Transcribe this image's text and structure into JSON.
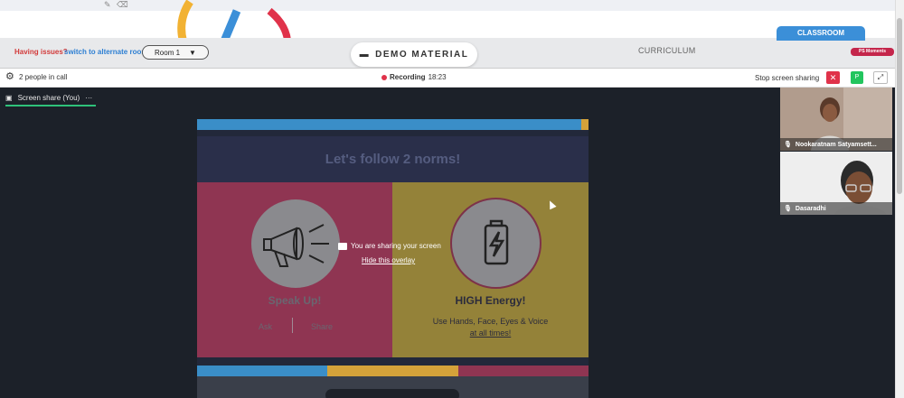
{
  "header": {
    "having_issues": "Having issues?",
    "switch_room": "switch to alternate room",
    "room": "Room 1",
    "demo_material": "DEMO MATERIAL",
    "curriculum": "CURRICULUM",
    "classroom": "CLASSROOM",
    "ps_moments": "PS Moments"
  },
  "callbar": {
    "people_in_call": "2 people in call",
    "recording_label": "Recording",
    "recording_time": "18:23",
    "stop_screen_sharing": "Stop screen sharing",
    "participant_initial": "P"
  },
  "screen_share_tab": {
    "label": "Screen share (You)",
    "menu": "···"
  },
  "slide": {
    "title": "Let's follow 2 norms!",
    "left_heading": "Speak Up!",
    "left_ask": "Ask",
    "left_share": "Share",
    "right_heading": "HIGH Energy!",
    "right_text": "Use Hands, Face, Eyes & Voice",
    "right_link": "at all times!"
  },
  "overlay": {
    "sharing_text": "You are sharing your screen",
    "hide_overlay": "Hide this overlay"
  },
  "participants": [
    {
      "name": "Nookaratnam Satyamsett..."
    },
    {
      "name": "Dasaradhi"
    }
  ],
  "colors": {
    "record_red": "#e0324a",
    "active_tab_green": "#2fc27a",
    "classroom_blue": "#3b8fd8"
  }
}
